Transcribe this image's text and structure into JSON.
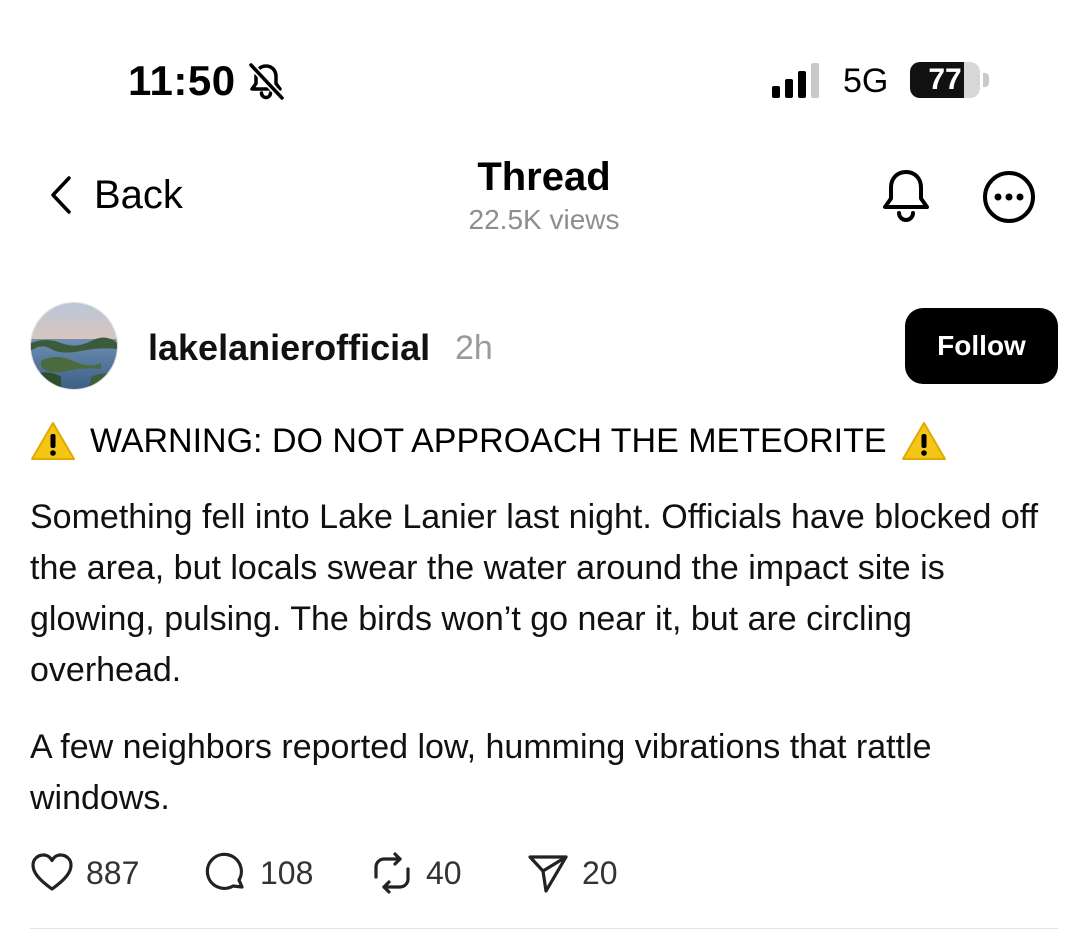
{
  "status_bar": {
    "time": "11:50",
    "mute_icon": "bell-slash-icon",
    "signal_icon": "cellular-signal-icon",
    "network": "5G",
    "battery_percent": "77",
    "battery_level": 0.77
  },
  "header": {
    "back_label": "Back",
    "back_icon": "chevron-left-icon",
    "title": "Thread",
    "views": "22.5K views",
    "notify_icon": "bell-icon",
    "more_icon": "ellipsis-circle-icon"
  },
  "post": {
    "username": "lakelanierofficial",
    "time_ago": "2h",
    "follow_label": "Follow",
    "warning_icon": "warning-triangle-icon",
    "warning_text": "WARNING: DO NOT APPROACH THE METEORITE",
    "paragraph_1": "Something fell into Lake Lanier last night. Officials have blocked off the area, but locals swear the water around the impact site is glowing, pulsing.  The birds won’t go near it, but are circling overhead.",
    "paragraph_2": "A few neighbors reported low, humming vibrations that rattle windows."
  },
  "actions": {
    "likes": "887",
    "replies": "108",
    "reposts": "40",
    "shares": "20",
    "like_icon": "heart-icon",
    "reply_icon": "comment-bubble-icon",
    "repost_icon": "repost-arrows-icon",
    "share_icon": "send-arrow-icon"
  },
  "colors": {
    "text": "#000000",
    "muted": "#8e8e8e",
    "follow_bg": "#000000",
    "warning_yellow": "#f5c518"
  }
}
